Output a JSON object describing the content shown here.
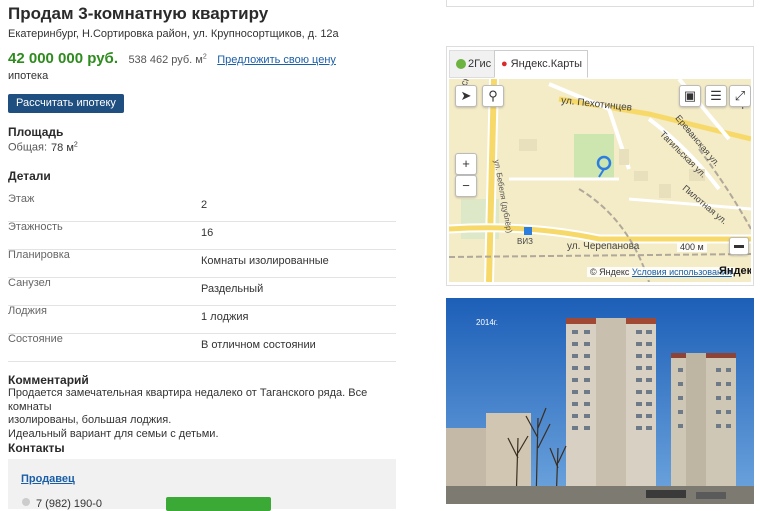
{
  "listing": {
    "title": "Продам 3-комнатную квартиру",
    "address": "Екатеринбург, Н.Сортировка район, ул. Крупносортщиков, д. 12а",
    "price": "42 000 000 руб.",
    "price_per_m2": "538 462 руб. м",
    "price_per_m2_sup": "2",
    "offer_price_link": "Предложить свою цену",
    "mortgage_note": "ипотека",
    "mortgage_button": "Рассчитать ипотеку"
  },
  "area": {
    "heading": "Площадь",
    "label": "Общая:",
    "value": "78 м",
    "value_sup": "2"
  },
  "details": {
    "heading": "Детали",
    "rows": [
      {
        "label": "Этаж",
        "value": "2"
      },
      {
        "label": "Этажность",
        "value": "16"
      },
      {
        "label": "Планировка",
        "value": "Комнаты изолированные"
      },
      {
        "label": "Санузел",
        "value": "Раздельный"
      },
      {
        "label": "Лоджия",
        "value": "1 лоджия"
      },
      {
        "label": "Состояние",
        "value": "В отличном состоянии"
      }
    ]
  },
  "comment": {
    "heading": "Комментарий",
    "line1": "Продается замечательная квартира недалеко от Таганского ряда. Все комнаты",
    "line2": "изолированы, большая лоджия.",
    "line3": "Идеальный вариант для семьи с детьми."
  },
  "contacts": {
    "heading": "Контакты",
    "seller_link": "Продавец",
    "phone": "7 (982) 190-0"
  },
  "map": {
    "tab_2gis": "2Гис",
    "tab_yandex": "Яндекс.Карты",
    "streets": {
      "pekhotintsev": "ул. Пехотинцев",
      "cherepanova": "ул. Черепанова",
      "erevanskaya": "Ереванская ул.",
      "tagilskaya": "Тагильская ул.",
      "pilotnaya": "Пилотная ул.",
      "bebelya": "ул. Бебеля (дублёр)",
      "left_street": "йская ул.",
      "ar": "Ар",
      "viz": "ВИЗ"
    },
    "scale": "400 м",
    "copyright": "© Яндекс",
    "terms": "Условия использования",
    "brand": "Яндекс",
    "zoom_in": "+",
    "zoom_out": "−"
  },
  "photo": {
    "year_badge": "2014г."
  }
}
